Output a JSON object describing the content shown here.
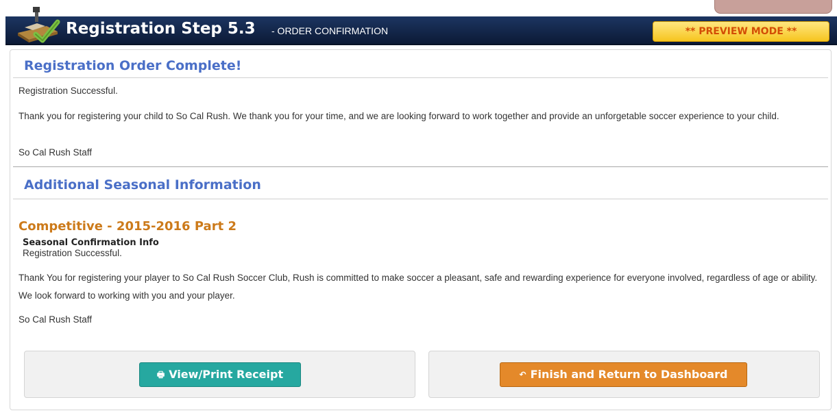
{
  "header": {
    "title": "Registration Step 5.3",
    "subtitle": "- ORDER CONFIRMATION",
    "preview_badge": "** PREVIEW MODE **",
    "icon": "registration-stamp-icon"
  },
  "order_complete": {
    "heading": "Registration Order Complete!",
    "status": "Registration Successful.",
    "message": "Thank you for registering your child to So Cal Rush. We thank you for your time, and we are looking forward to work together and provide an unforgetable soccer experience to your child.",
    "signature": "So Cal Rush Staff"
  },
  "seasonal": {
    "heading": "Additional Seasonal Information",
    "season_name": "Competitive - 2015-2016 Part 2",
    "info_label": "Seasonal Confirmation Info",
    "status": "Registration Successful.",
    "message": "Thank You for registering your player to So Cal Rush Soccer Club, Rush is committed to make soccer a pleasant, safe and rewarding experience for everyone involved, regardless of age or ability. We look forward to working with you and your player.",
    "signature": "So Cal Rush Staff"
  },
  "actions": {
    "receipt_label": "View/Print Receipt",
    "receipt_icon": "print-icon",
    "finish_label": "Finish and Return to Dashboard",
    "finish_icon": "return-arrow-icon"
  },
  "colors": {
    "header_bg": "#0c1a36",
    "section_heading": "#4a6fc7",
    "season_heading": "#cc7a1a",
    "preview_badge_text": "#d34d05",
    "receipt_button": "#26a8a0",
    "finish_button": "#e4892a"
  }
}
